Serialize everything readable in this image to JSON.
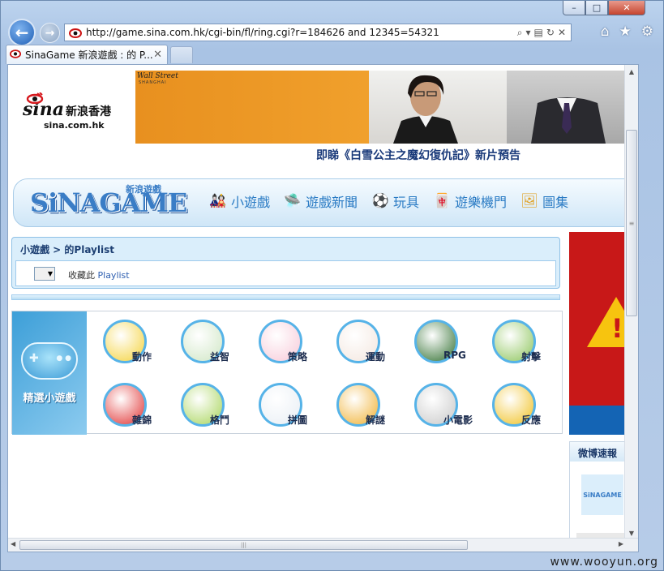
{
  "window": {
    "controls": [
      "–",
      "□",
      "✕"
    ]
  },
  "toolbar": {
    "url": "http://game.sina.com.hk/cgi-bin/fl/ring.cgi?r=184626 and 12345=54321"
  },
  "tab": {
    "title": "SinaGame 新浪遊戲 : 的 P...",
    "close": "✕"
  },
  "header": {
    "logo_word": "sina",
    "logo_hk": "新浪香港",
    "logo_domain": "sina.com.hk",
    "banner_brand": "Wall Street",
    "banner_sub": "SHANGHAI",
    "banner_caption": "即睇《白雪公主之魔幻復仇記》新片預告"
  },
  "navbar": {
    "logo": "SiNAGAME",
    "tag": "新浪遊戲",
    "items": [
      {
        "label": "小遊戲",
        "icon": "doll-icon",
        "glyph": "🎎",
        "color": "#d8273f"
      },
      {
        "label": "遊戲新聞",
        "icon": "ufo-icon",
        "glyph": "🛸",
        "color": "#3c8d3c"
      },
      {
        "label": "玩具",
        "icon": "ball-icon",
        "glyph": "⚽",
        "color": "#d8273f"
      },
      {
        "label": "遊樂機門",
        "icon": "mahjong-icon",
        "glyph": "🀄",
        "color": "#3c8d3c"
      },
      {
        "label": "圖集",
        "icon": "photo-icon",
        "glyph": "🖼",
        "color": "#e0a020"
      }
    ]
  },
  "playlist": {
    "breadcrumb": "小遊戲 > 的Playlist",
    "collect_text": "收藏此",
    "collect_link": "Playlist"
  },
  "games": {
    "tile_label": "精選小遊戲",
    "categories": [
      {
        "label": "動作",
        "bg": "#f4d23a"
      },
      {
        "label": "益智",
        "bg": "#cfe6c4"
      },
      {
        "label": "策略",
        "bg": "#f7c9d8"
      },
      {
        "label": "運動",
        "bg": "#f3e6de"
      },
      {
        "label": "RPG",
        "bg": "#2f6e2e"
      },
      {
        "label": "射擊",
        "bg": "#8cc45a"
      },
      {
        "label": "雜錦",
        "bg": "#e03030"
      },
      {
        "label": "格鬥",
        "bg": "#a7d45a"
      },
      {
        "label": "拼圖",
        "bg": "#e8eef4"
      },
      {
        "label": "解謎",
        "bg": "#f0b030"
      },
      {
        "label": "小電影",
        "bg": "#c8c8c8"
      },
      {
        "label": "反應",
        "bg": "#f0c020"
      }
    ]
  },
  "sidebar": {
    "weibo_title": "微博速報",
    "weibo_logo": "SiNAGAME"
  },
  "watermark": "www.wooyun.org"
}
